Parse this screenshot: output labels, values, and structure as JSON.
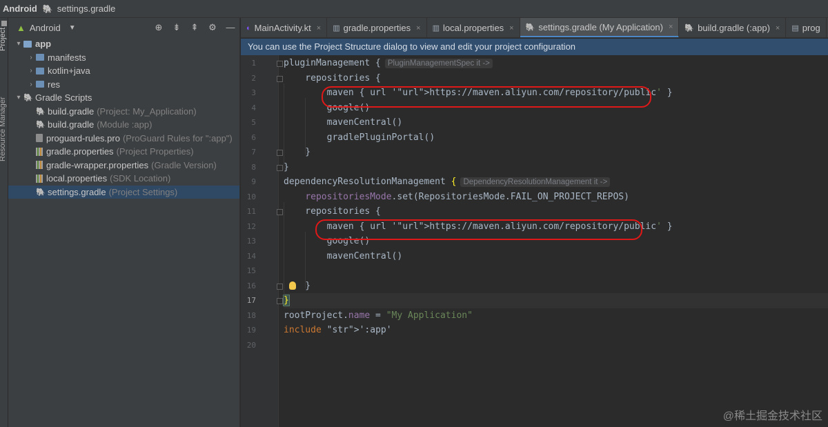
{
  "titlebar": {
    "project": "Android",
    "file": "settings.gradle"
  },
  "strip": {
    "project": "Project",
    "resource_manager": "Resource Manager"
  },
  "panel": {
    "view_selector": "Android",
    "tools": [
      "locate-icon",
      "expand-all-icon",
      "collapse-all-icon",
      "gear-icon",
      "minimize-icon"
    ],
    "tree": [
      {
        "label": "app",
        "hint": "",
        "level": 0,
        "arrow": "▾",
        "icon": "folder",
        "bold": true
      },
      {
        "label": "manifests",
        "hint": "",
        "level": 1,
        "arrow": "›",
        "icon": "folder"
      },
      {
        "label": "kotlin+java",
        "hint": "",
        "level": 1,
        "arrow": "›",
        "icon": "folder"
      },
      {
        "label": "res",
        "hint": "",
        "level": 1,
        "arrow": "›",
        "icon": "folder"
      },
      {
        "label": "Gradle Scripts",
        "hint": "",
        "level": 0,
        "arrow": "▾",
        "icon": "gradle"
      },
      {
        "label": "build.gradle",
        "hint": "(Project: My_Application)",
        "level": 1,
        "arrow": "",
        "icon": "gradle"
      },
      {
        "label": "build.gradle",
        "hint": "(Module :app)",
        "level": 1,
        "arrow": "",
        "icon": "gradle"
      },
      {
        "label": "proguard-rules.pro",
        "hint": "(ProGuard Rules for \":app\")",
        "level": 1,
        "arrow": "",
        "icon": "pro"
      },
      {
        "label": "gradle.properties",
        "hint": "(Project Properties)",
        "level": 1,
        "arrow": "",
        "icon": "prop"
      },
      {
        "label": "gradle-wrapper.properties",
        "hint": "(Gradle Version)",
        "level": 1,
        "arrow": "",
        "icon": "prop"
      },
      {
        "label": "local.properties",
        "hint": "(SDK Location)",
        "level": 1,
        "arrow": "",
        "icon": "prop"
      },
      {
        "label": "settings.gradle",
        "hint": "(Project Settings)",
        "level": 1,
        "arrow": "",
        "icon": "gradle",
        "selected": true
      }
    ]
  },
  "tabs": [
    {
      "label": "MainActivity.kt",
      "icon": "kotlin"
    },
    {
      "label": "gradle.properties",
      "icon": "prop"
    },
    {
      "label": "local.properties",
      "icon": "prop"
    },
    {
      "label": "settings.gradle (My Application)",
      "icon": "gradle",
      "active": true
    },
    {
      "label": "build.gradle (:app)",
      "icon": "gradle"
    },
    {
      "label": "prog",
      "icon": "pro"
    }
  ],
  "notice": "You can use the Project Structure dialog to view and edit your project configuration",
  "editor": {
    "current_line": 17,
    "inlay_plugin": "PluginManagementSpec it ->",
    "inlay_dep": "DependencyResolutionManagement it ->",
    "lines": [
      "pluginManagement {",
      "    repositories {",
      "        maven { url 'https://maven.aliyun.com/repository/public' }",
      "        google()",
      "        mavenCentral()",
      "        gradlePluginPortal()",
      "    }",
      "}",
      "dependencyResolutionManagement {",
      "    repositoriesMode.set(RepositoriesMode.FAIL_ON_PROJECT_REPOS)",
      "    repositories {",
      "        maven { url 'https://maven.aliyun.com/repository/public' }",
      "        google()",
      "        mavenCentral()",
      "",
      "    }",
      "}",
      "rootProject.name = \"My Application\"",
      "include ':app'",
      ""
    ]
  },
  "watermark": "@稀土掘金技术社区"
}
